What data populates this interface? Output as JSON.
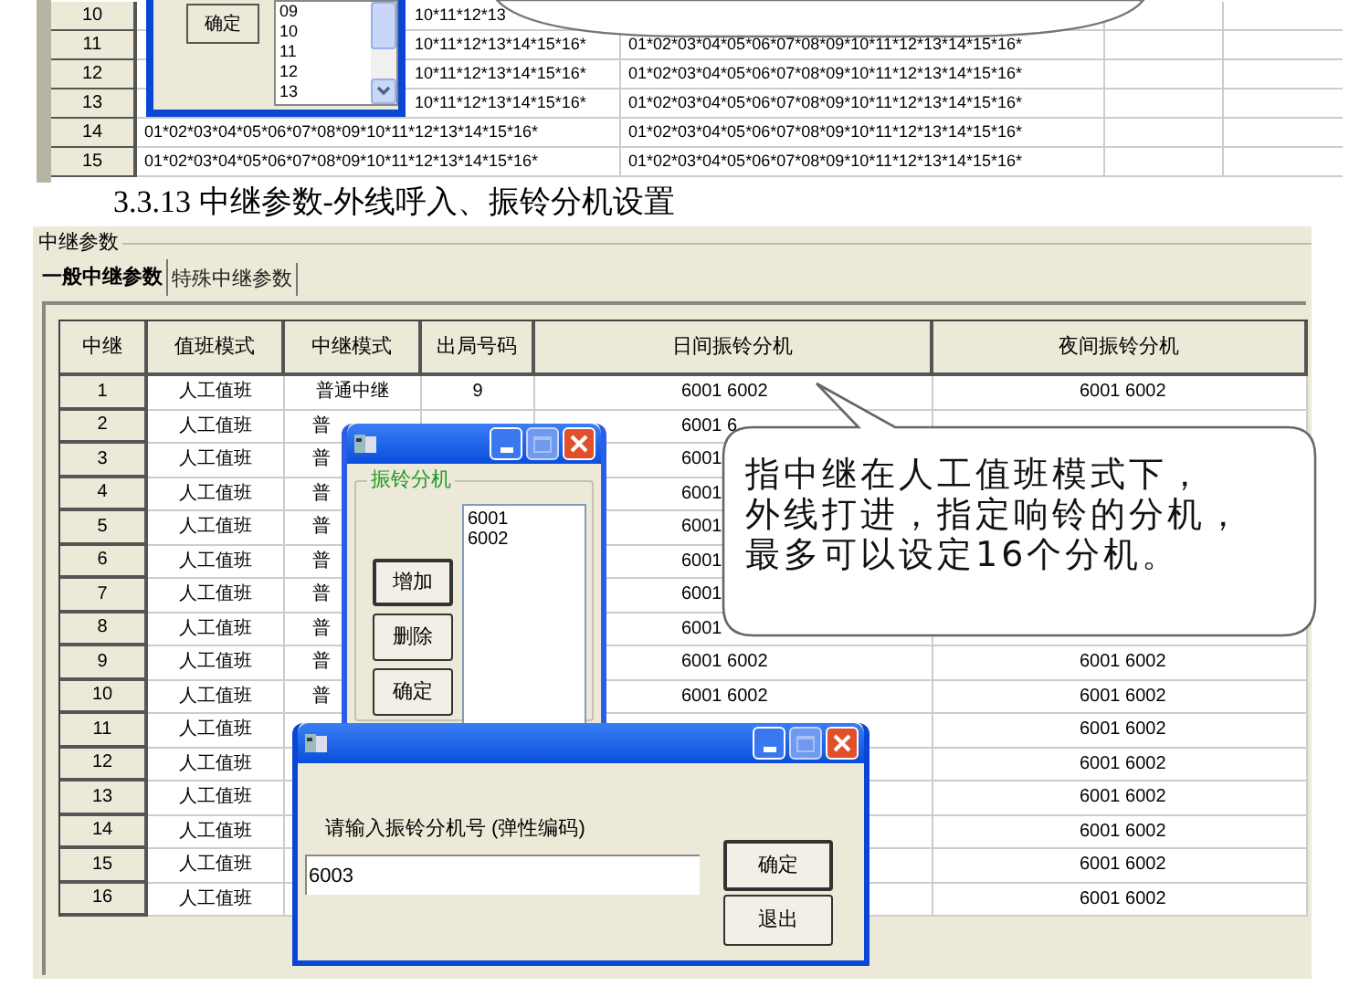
{
  "previous_screenshot": {
    "dialog": {
      "button": "确定",
      "list_items": [
        "09",
        "10",
        "11",
        "12",
        "13"
      ]
    },
    "rows": [
      {
        "number": "10",
        "column_1": "10*11*12*13"
      },
      {
        "number": "11",
        "column_1": "10*11*12*13*14*15*16*",
        "column_2": "01*02*03*04*05*06*07*08*09*10*11*12*13*14*15*16*"
      },
      {
        "number": "12",
        "column_1": "10*11*12*13*14*15*16*",
        "column_2": "01*02*03*04*05*06*07*08*09*10*11*12*13*14*15*16*"
      },
      {
        "number": "13",
        "column_1": "10*11*12*13*14*15*16*",
        "column_2": "01*02*03*04*05*06*07*08*09*10*11*12*13*14*15*16*"
      },
      {
        "number": "14",
        "column_1": "01*02*03*04*05*06*07*08*09*10*11*12*13*14*15*16*",
        "column_2": "01*02*03*04*05*06*07*08*09*10*11*12*13*14*15*16*"
      },
      {
        "number": "15",
        "column_1": "01*02*03*04*05*06*07*08*09*10*11*12*13*14*15*16*",
        "column_2": "01*02*03*04*05*06*07*08*09*10*11*12*13*14*15*16*"
      }
    ]
  },
  "heading": "3.3.13 中继参数-外线呼入、振铃分机设置",
  "group_title": "中继参数",
  "tabs": [
    {
      "label": "一般中继参数",
      "selected": true
    },
    {
      "label": "特殊中继参数",
      "selected": false
    }
  ],
  "table": {
    "columns": [
      "中继",
      "值班模式",
      "中继模式",
      "出局号码",
      "日间振铃分机",
      "夜间振铃分机"
    ],
    "rows": [
      {
        "number": "1",
        "duty_mode": "人工值班",
        "trunk_mode": "普通中继",
        "outgoing_code": "9",
        "day_ring": "6001 6002",
        "night_ring": "6001 6002"
      },
      {
        "number": "2",
        "duty_mode": "人工值班",
        "trunk_mode": "普",
        "day_ring": "6001 6"
      },
      {
        "number": "3",
        "duty_mode": "人工值班",
        "trunk_mode": "普",
        "day_ring": "6001"
      },
      {
        "number": "4",
        "duty_mode": "人工值班",
        "trunk_mode": "普",
        "day_ring": "6001"
      },
      {
        "number": "5",
        "duty_mode": "人工值班",
        "trunk_mode": "普",
        "day_ring": "6001"
      },
      {
        "number": "6",
        "duty_mode": "人工值班",
        "trunk_mode": "普",
        "day_ring": "6001"
      },
      {
        "number": "7",
        "duty_mode": "人工值班",
        "trunk_mode": "普",
        "day_ring": "6001"
      },
      {
        "number": "8",
        "duty_mode": "人工值班",
        "trunk_mode": "普",
        "day_ring": "6001"
      },
      {
        "number": "9",
        "duty_mode": "人工值班",
        "trunk_mode": "普",
        "day_ring": "6001 6002",
        "night_ring": "6001 6002"
      },
      {
        "number": "10",
        "duty_mode": "人工值班",
        "trunk_mode": "普",
        "day_ring": "6001 6002",
        "night_ring": "6001 6002"
      },
      {
        "number": "11",
        "duty_mode": "人工值班",
        "night_ring": "6001 6002"
      },
      {
        "number": "12",
        "duty_mode": "人工值班",
        "night_ring": "6001 6002"
      },
      {
        "number": "13",
        "duty_mode": "人工值班",
        "night_ring": "6001 6002"
      },
      {
        "number": "14",
        "duty_mode": "人工值班",
        "night_ring": "6001 6002"
      },
      {
        "number": "15",
        "duty_mode": "人工值班",
        "night_ring": "6001 6002"
      },
      {
        "number": "16",
        "duty_mode": "人工值班",
        "night_ring": "6001 6002"
      }
    ]
  },
  "ring_dialog": {
    "group_label": "振铃分机",
    "list_items": [
      "6001",
      "6002"
    ],
    "buttons": [
      "增加",
      "删除",
      "确定"
    ]
  },
  "input_dialog": {
    "prompt": "请输入振铃分机号 (弹性编码)",
    "value": "6003",
    "buttons": [
      "确定",
      "退出"
    ]
  },
  "callout": [
    "指中继在人工值班模式下，",
    "外线打进，指定响铃的分机，",
    "最多可以设定16个分机。"
  ]
}
